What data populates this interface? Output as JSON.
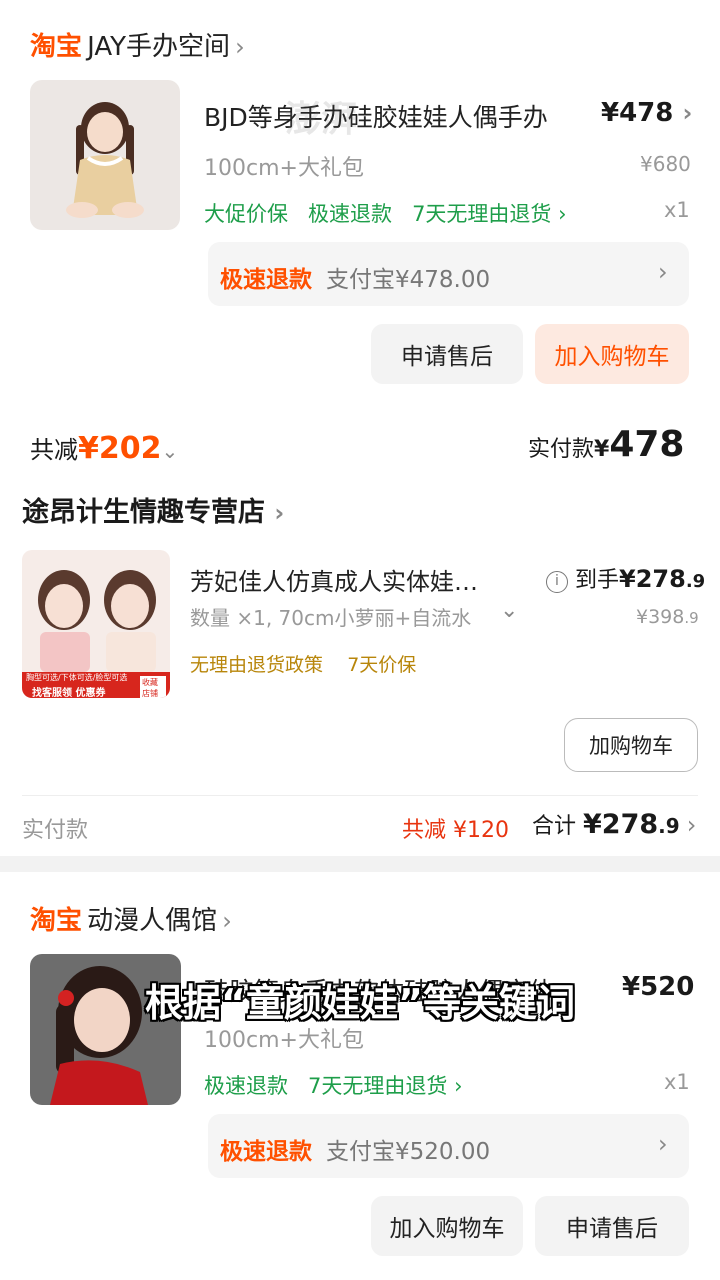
{
  "order1": {
    "shop_logo": "淘宝",
    "shop_name": "JAY手办空间",
    "product_title": "BJD等身手办硅胶娃娃人偶手办",
    "price": "¥478",
    "variant": "100cm+大礼包",
    "original_price": "¥680",
    "tags": [
      "大促价保",
      "极速退款",
      "7天无理由退货"
    ],
    "quantity": "x1",
    "refund_label": "极速退款",
    "refund_detail": "支付宝¥478.00",
    "btn_after_sale": "申请售后",
    "btn_add_cart": "加入购物车",
    "discount_label": "共减",
    "discount_value": "¥202",
    "paid_label": "实付款",
    "paid_currency": "¥",
    "paid_value": "478"
  },
  "order2": {
    "shop_name": "途昂计生情趣专营店",
    "product_title": "芳妃佳人仿真成人实体娃…",
    "arrival_label": "到手",
    "arrival_price_main": "¥278",
    "arrival_price_dec": ".9",
    "variant": "数量 ×1, 70cm小萝丽+自流水",
    "original_price_main": "¥398",
    "original_price_dec": ".9",
    "tags": [
      "无理由退货政策",
      "7天价保"
    ],
    "btn_add_cart": "加购物车",
    "paid_label": "实付款",
    "discount_text": "共减 ¥120",
    "total_label": "合计",
    "total_main": "¥278",
    "total_dec": ".9",
    "thumb_caption": "找客服领   优惠券",
    "thumb_caption2": "胸型可选/下体可选/脸型可选",
    "thumb_fav": "收藏 店铺"
  },
  "order3": {
    "shop_logo": "淘宝",
    "shop_name": "动漫人偶馆",
    "product_title": "硅胶等身手办软体硅胶人偶实体",
    "price": "¥520",
    "variant": "100cm+大礼包",
    "tags": [
      "极速退款",
      "7天无理由退货"
    ],
    "quantity": "x1",
    "refund_label": "极速退款",
    "refund_detail": "支付宝¥520.00",
    "btn_add_cart": "加入购物车",
    "btn_after_sale": "申请售后"
  },
  "subtitle": "根据“童颜娃娃”等关键词",
  "colors": {
    "accent": "#ff5000",
    "green": "#1e9e4a",
    "gold": "#b8860b",
    "red": "#e8340f"
  }
}
